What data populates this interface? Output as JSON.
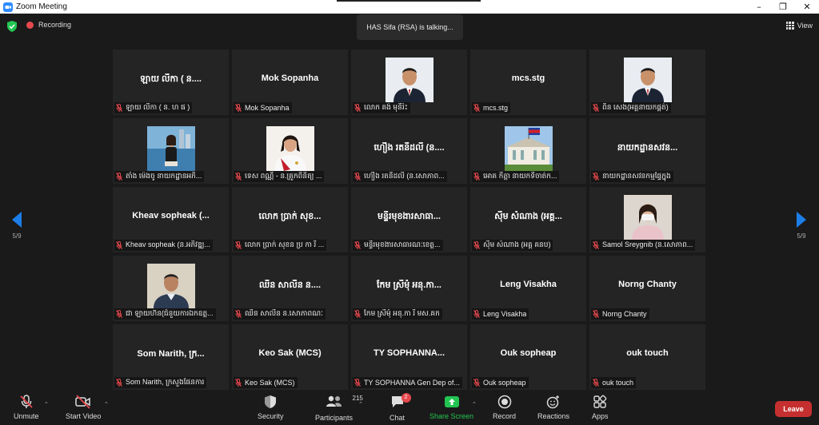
{
  "window": {
    "title": "Zoom Meeting"
  },
  "status": {
    "recording_label": "Recording",
    "talking_text": "HAS Sifa (RSA) is talking...",
    "view_label": "View"
  },
  "pager": {
    "left_label": "5/9",
    "right_label": "5/9"
  },
  "tiles": [
    {
      "big": "ឡាយ លីកា ( ន....",
      "name": "ឡាយ លីកា ( ន. ហ ផ )",
      "photo": false
    },
    {
      "big": "Mok Sopanha",
      "name": "Mok Sopanha",
      "photo": false
    },
    {
      "big": "",
      "name": "លោក គង់ មុនីរ៉ះ",
      "photo": true,
      "photo_icon": "man-in-suit-portrait"
    },
    {
      "big": "mcs.stg",
      "name": "mcs.stg",
      "photo": false
    },
    {
      "big": "",
      "name": "ពិន សេង(អគ្គនាយកផ្គត់)",
      "photo": true,
      "photo_icon": "man-in-suit-portrait"
    },
    {
      "big": "",
      "name": "តាំង ម៉េងចូ នាយកដ្ឋានអភិ...",
      "photo": true,
      "photo_icon": "woman-by-water-photo"
    },
    {
      "big": "",
      "name": "ទេស ពណ្ណី - ន.គ្រូកពិនិត្យ ...",
      "photo": true,
      "photo_icon": "woman-in-uniform-portrait"
    },
    {
      "big": "ហឿង រតនីដលី (ន....",
      "name": "ហឿង រតនីដលី (ន.សោភាព...",
      "photo": false
    },
    {
      "big": "",
      "name": "អោគ កីត្តា នាយកទីចាត់ក...",
      "photo": true,
      "photo_icon": "building-with-flag-photo"
    },
    {
      "big": "នាយកដ្ឋានសវន...",
      "name": "នាយកដ្ឋានសវនកម្មផ្ទៃក្នុង",
      "photo": false
    },
    {
      "big": "Kheav sopheak (...",
      "name": "Kheav sopheak (ន.អភិវឌ្ឍ...",
      "photo": false
    },
    {
      "big": "លោក ប្រាក់ សុខ...",
      "name": "លោក ប្រាក់ សុខន ប្រ កា រី ...",
      "photo": false
    },
    {
      "big": "មន្ទីរមុខងារសាធា...",
      "name": "មន្ទីរមុខងារសាធារណៈខេត្ត...",
      "photo": false
    },
    {
      "big": "ស៊ឹម សំណាង (អគ្គ...",
      "name": "ស៊ឹម សំណាង (អគ្គ គនប)",
      "photo": false
    },
    {
      "big": "",
      "name": "Samol Sreygnib (ន.សោភាព...",
      "photo": true,
      "photo_icon": "woman-with-mask-photo"
    },
    {
      "big": "",
      "name": "ជា ឡាយហ៊ន(ជំនួយការឯកឧត្ត...",
      "photo": true,
      "photo_icon": "man-portrait"
    },
    {
      "big": "ឈឹន សាលីន ន....",
      "name": "ឈឹន សាលីន ន.សោភាពណៈ",
      "photo": false
    },
    {
      "big": "កែម ស្រីមុំ អនុ.កា...",
      "name": "កែម ស្រីមុំ អនុ.កា រី មស.គក",
      "photo": false
    },
    {
      "big": "Leng Visakha",
      "name": "Leng Visakha",
      "photo": false
    },
    {
      "big": "Norng Chanty",
      "name": "Norng Chanty",
      "photo": false
    },
    {
      "big": "Som  Narith, ក្រ...",
      "name": "Som Narith, ក្រសួងផែនការ",
      "photo": false
    },
    {
      "big": "Keo Sak (MCS)",
      "name": "Keo Sak (MCS)",
      "photo": false
    },
    {
      "big": "TY SOPHANNA...",
      "name": "TY SOPHANNA Gen Dep of...",
      "photo": false
    },
    {
      "big": "Ouk sopheap",
      "name": "Ouk sopheap",
      "photo": false
    },
    {
      "big": "ouk touch",
      "name": "ouk touch",
      "photo": false
    }
  ],
  "toolbar": {
    "unmute": "Unmute",
    "start_video": "Start Video",
    "security": "Security",
    "participants": "Participants",
    "participants_count": "215",
    "chat": "Chat",
    "chat_badge": "2",
    "share_screen": "Share Screen",
    "record": "Record",
    "reactions": "Reactions",
    "apps": "Apps",
    "leave": "Leave"
  },
  "colors": {
    "accent": "#1d7ee8",
    "share_green": "#23c552",
    "leave_red": "#c62f2f",
    "muted_red": "#e5484d"
  }
}
